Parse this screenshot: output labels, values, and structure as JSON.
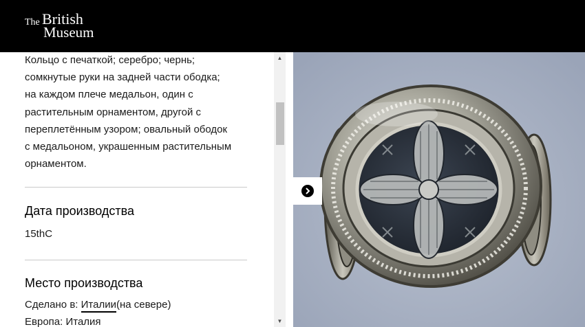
{
  "header": {
    "logo_the": "The",
    "logo_british": "British",
    "logo_museum": "Museum"
  },
  "description": "Кольцо с печаткой; серебро; чернь;\nсомкнутые руки на задней части ободка;\nна каждом плече медальон, один с\nрастительным орнаментом, другой с\nпереплетённым узором; овальный ободок\nс медальоном, украшенным растительным\nорнаментом.",
  "production_date": {
    "heading": "Дата производства",
    "value": "15thC"
  },
  "production_place": {
    "heading": "Место производства",
    "made_in_label": "Сделано в:",
    "made_in_link": "Италии",
    "made_in_suffix": "(на севере)",
    "region": "Европа: Италия"
  },
  "colors": {
    "header_bg": "#000000",
    "image_bg": "#a8b1c3"
  },
  "icons": {
    "next": "chevron-right-icon",
    "scroll_up": "triangle-up-icon",
    "scroll_down": "triangle-down-icon"
  }
}
